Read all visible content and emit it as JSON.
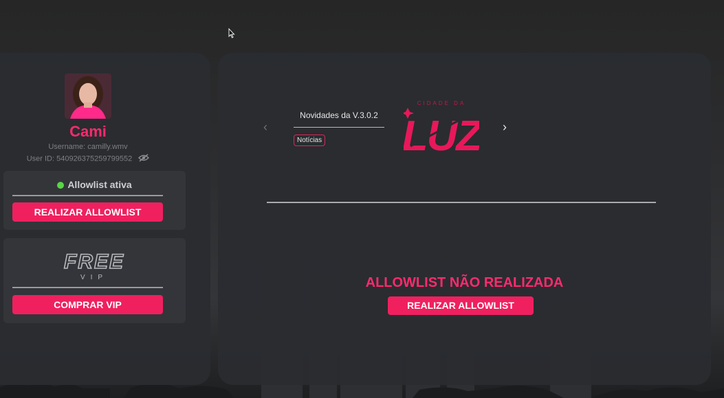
{
  "profile": {
    "name": "Cami",
    "username_line": "Username: camilly.wmv",
    "userid_line": "User ID: 540926375259799552"
  },
  "allowlist_card": {
    "status": "Allowlist ativa",
    "button": "REALIZAR ALLOWLIST"
  },
  "vip_card": {
    "logo_text": "FREE",
    "logo_sub": "VIP",
    "button": "COMPRAR VIP"
  },
  "news": {
    "title": "Novidades da V.3.0.2",
    "badge": "Notícias",
    "prev_arrow": "‹",
    "next_arrow": "›"
  },
  "brand": {
    "logo_text": "LUZ",
    "logo_small": "CIDADE DA"
  },
  "main_status": {
    "text": "ALLOWLIST NÃO REALIZADA",
    "button": "REALIZAR ALLOWLIST"
  },
  "colors": {
    "accent": "#f0205f",
    "status_green": "#58d645",
    "panel": "#2a2c30"
  }
}
